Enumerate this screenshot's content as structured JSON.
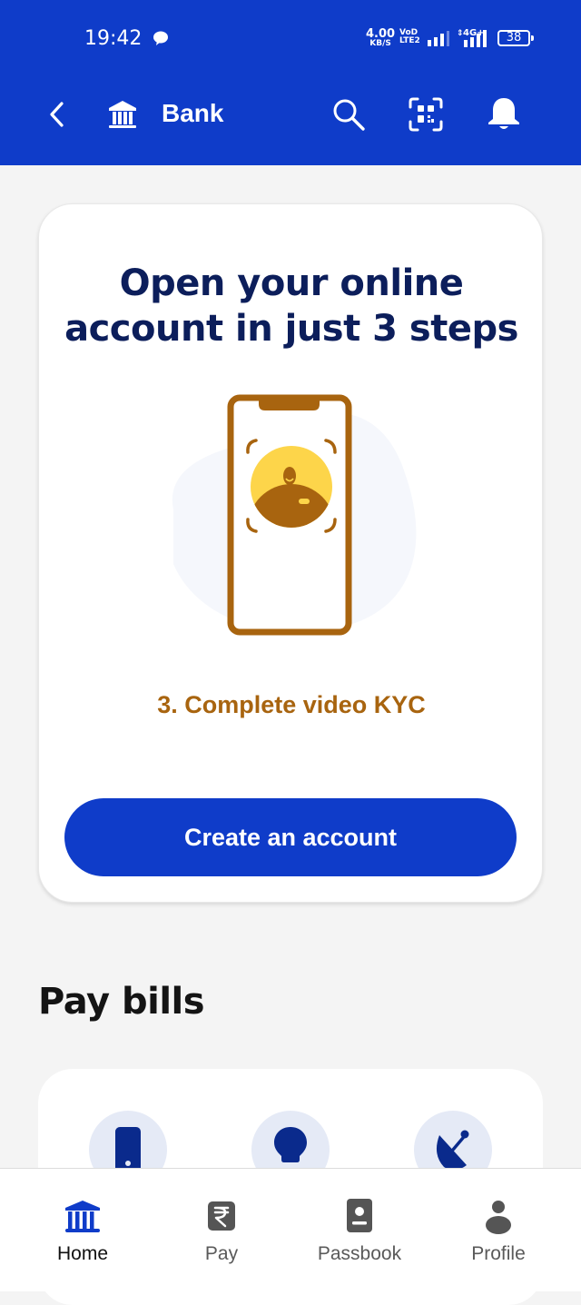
{
  "status_bar": {
    "time": "19:42",
    "net_speed_value": "4.00",
    "net_speed_unit": "KB/S",
    "volte_top": "VoD",
    "volte_bottom": "LTE2",
    "network_type": "4G+",
    "battery": "38"
  },
  "app_bar": {
    "title": "Bank",
    "back_icon": "chevron-left-icon",
    "title_icon": "bank-icon",
    "actions": [
      "search-icon",
      "qr-scan-icon",
      "bell-icon"
    ]
  },
  "promo": {
    "title_line1": "Open your online",
    "title_line2": "account in just 3 steps",
    "step_text": "3. Complete video KYC",
    "cta_label": "Create an account"
  },
  "pay_bills": {
    "title": "Pay bills",
    "items": [
      {
        "icon": "mobile-phone-icon"
      },
      {
        "icon": "lightbulb-icon"
      },
      {
        "icon": "satellite-dish-icon"
      }
    ]
  },
  "bottom_nav": {
    "items": [
      {
        "label": "Home",
        "icon": "bank-icon",
        "active": true
      },
      {
        "label": "Pay",
        "icon": "rupee-icon",
        "active": false
      },
      {
        "label": "Passbook",
        "icon": "passbook-icon",
        "active": false
      },
      {
        "label": "Profile",
        "icon": "profile-icon",
        "active": false
      }
    ]
  },
  "colors": {
    "brand_blue": "#0f3cc9",
    "title_navy": "#0c1e5b",
    "accent_brown": "#a8640f",
    "illustration_yellow": "#fdd54a",
    "icon_navy": "#0a2a8c"
  }
}
